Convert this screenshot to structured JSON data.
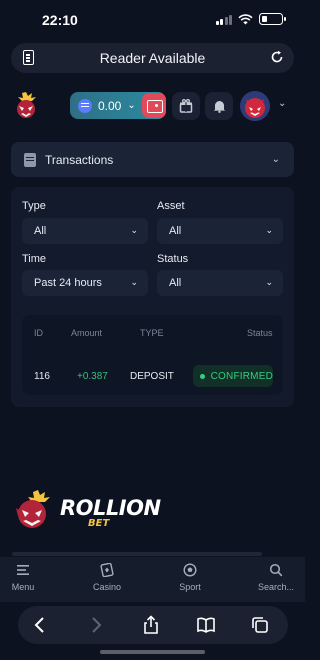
{
  "status_bar": {
    "time": "22:10"
  },
  "reader_bar": {
    "title": "Reader Available"
  },
  "header": {
    "balance_amount": "0.00",
    "colors": {
      "wallet": "#e24a5a",
      "balance_bg": "#2f6f86"
    }
  },
  "transactions_dropdown": {
    "label": "Transactions"
  },
  "filters": {
    "type": {
      "label": "Type",
      "value": "All"
    },
    "asset": {
      "label": "Asset",
      "value": "All"
    },
    "time": {
      "label": "Time",
      "value": "Past 24 hours"
    },
    "status": {
      "label": "Status",
      "value": "All"
    }
  },
  "table": {
    "headers": [
      "ID",
      "Amount",
      "TYPE",
      "Status"
    ],
    "rows": [
      {
        "id": "116",
        "amount": "+0.387",
        "type": "DEPOSIT",
        "status": "CONFIRMED"
      }
    ]
  },
  "brand": {
    "name": "ROLLION",
    "sub": "BET"
  },
  "bottom_nav": {
    "items": [
      {
        "label": "Menu",
        "icon": "menu-icon"
      },
      {
        "label": "Casino",
        "icon": "casino-icon"
      },
      {
        "label": "Sport",
        "icon": "sport-ball-icon"
      },
      {
        "label": "Search...",
        "icon": "search-icon"
      }
    ]
  }
}
